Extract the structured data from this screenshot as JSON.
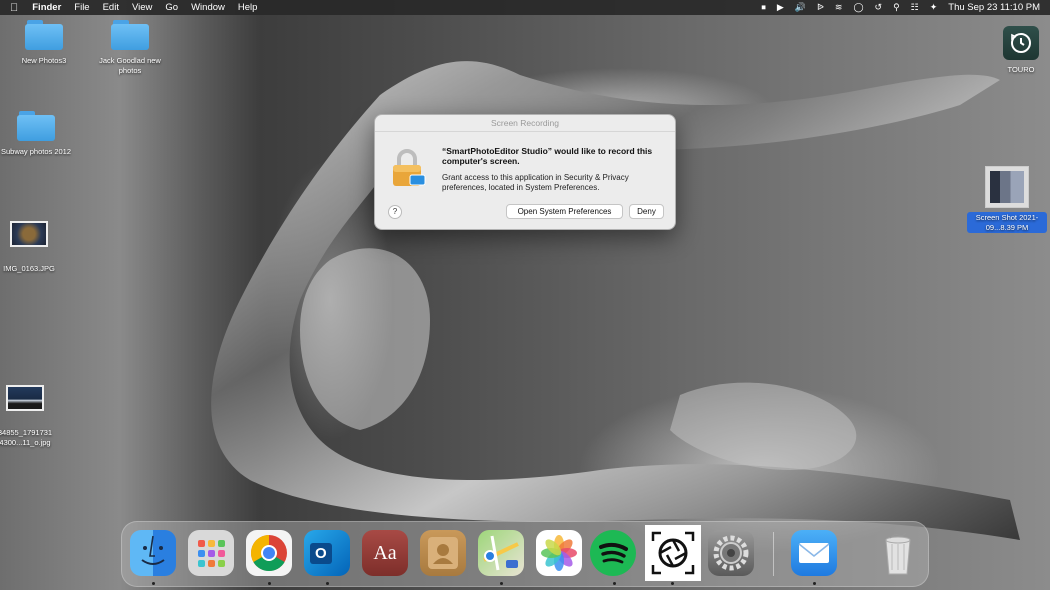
{
  "menubar": {
    "apple_icon": "apple-logo-icon",
    "app_name": "Finder",
    "menus": [
      "File",
      "Edit",
      "View",
      "Go",
      "Window",
      "Help"
    ],
    "datetime": "Thu Sep 23  11:10 PM"
  },
  "desktop": {
    "icons": [
      {
        "label": "New Photos3",
        "type": "folder"
      },
      {
        "label": "Jack Goodlad new photos",
        "type": "folder"
      },
      {
        "label": "Subway photos 2012",
        "type": "folder"
      },
      {
        "label": "IMG_0163.JPG",
        "type": "image"
      },
      {
        "label": "34855_1791731 4300...11_o.jpg",
        "type": "image"
      },
      {
        "label": "TOURO",
        "type": "time-machine-drive"
      },
      {
        "label": "Screen Shot 2021-09...8.39 PM",
        "type": "screenshot"
      }
    ]
  },
  "dialog": {
    "title": "Screen Recording",
    "headline": "“SmartPhotoEditor Studio” would like to record this computer's screen.",
    "body": "Grant access to this application in Security & Privacy preferences, located in System Preferences.",
    "help_label": "?",
    "open_prefs_label": "Open System Preferences",
    "deny_label": "Deny"
  },
  "dock": {
    "apps": [
      "Finder",
      "Launchpad",
      "Chrome",
      "Outlook",
      "Dictionary",
      "Contacts",
      "Maps",
      "Photos",
      "Spotify",
      "Screenshot",
      "System Preferences",
      "Mail",
      "Trash"
    ],
    "dictionary_glyph": "Aa",
    "outlook_glyph": "O"
  },
  "colors": {
    "accent": "#2b6ad8",
    "folder_blue": "#4aa3e6"
  }
}
